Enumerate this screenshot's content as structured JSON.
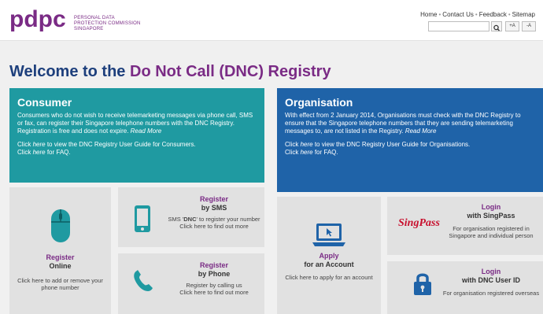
{
  "header": {
    "logo_letters": "pdpc",
    "logo_lines": [
      "PERSONAL DATA",
      "PROTECTION COMMISSION",
      "SINGAPORE"
    ],
    "links": [
      "Home",
      "Contact Us",
      "Feedback",
      "Sitemap"
    ],
    "font_increase": "+A",
    "font_decrease": "-A"
  },
  "welcome": {
    "prefix": "Welcome to the",
    "accent": "Do Not Call (DNC) Registry"
  },
  "consumer": {
    "heading": "Consumer",
    "intro": "Consumers who do not wish to receive telemarketing messages via phone call, SMS or fax, can register their Singapore telephone numbers with the DNC Registry. Registration is free and does not expire.",
    "read_more": "Read More",
    "guide_pre": "Click",
    "guide_link": "here",
    "guide_post": "to view the DNC Registry User Guide for Consumers.",
    "faq_pre": "Click",
    "faq_link": "here",
    "faq_post": "for FAQ."
  },
  "organisation": {
    "heading": "Organisation",
    "intro": "With effect from 2 January 2014, Organisations must check with the DNC Registry to ensure that the Singapore telephone numbers that they are sending telemarketing messages to, are not listed in the Registry.",
    "read_more": "Read More",
    "guide_pre": "Click",
    "guide_link": "here",
    "guide_post": "to view the DNC Registry User Guide for Organisations.",
    "faq_pre": "Click",
    "faq_link": "here",
    "faq_post": "for FAQ."
  },
  "tiles": {
    "register_online": {
      "title": "Register",
      "subtitle": "Online",
      "desc": "Click here to add or remove your phone number",
      "icon": "mouse-icon"
    },
    "register_sms": {
      "title": "Register",
      "subtitle": "by SMS",
      "desc_pre": "SMS '",
      "desc_bold": "DNC",
      "desc_post": "' to register your number",
      "desc2": "Click here to find out more",
      "icon": "mobile-phone-icon"
    },
    "register_phone": {
      "title": "Register",
      "subtitle": "by Phone",
      "desc": "Register by calling us",
      "desc2": "Click here to find out more",
      "icon": "phone-handset-icon"
    },
    "apply_account": {
      "title": "Apply",
      "subtitle": "for an Account",
      "desc": "Click here to apply for an account",
      "icon": "laptop-icon"
    },
    "login_singpass": {
      "title": "Login",
      "subtitle": "with SingPass",
      "logo_text": "SingPass",
      "desc": "For organisation registered in Singapore and individual person"
    },
    "login_dnc": {
      "title": "Login",
      "subtitle": "with DNC User ID",
      "desc": "For organisation registered overseas",
      "icon": "padlock-icon"
    }
  },
  "colors": {
    "consumer": "#1f9aa1",
    "organisation": "#1f63a8",
    "accent": "#7a2b85",
    "heading": "#1d3f7c"
  }
}
